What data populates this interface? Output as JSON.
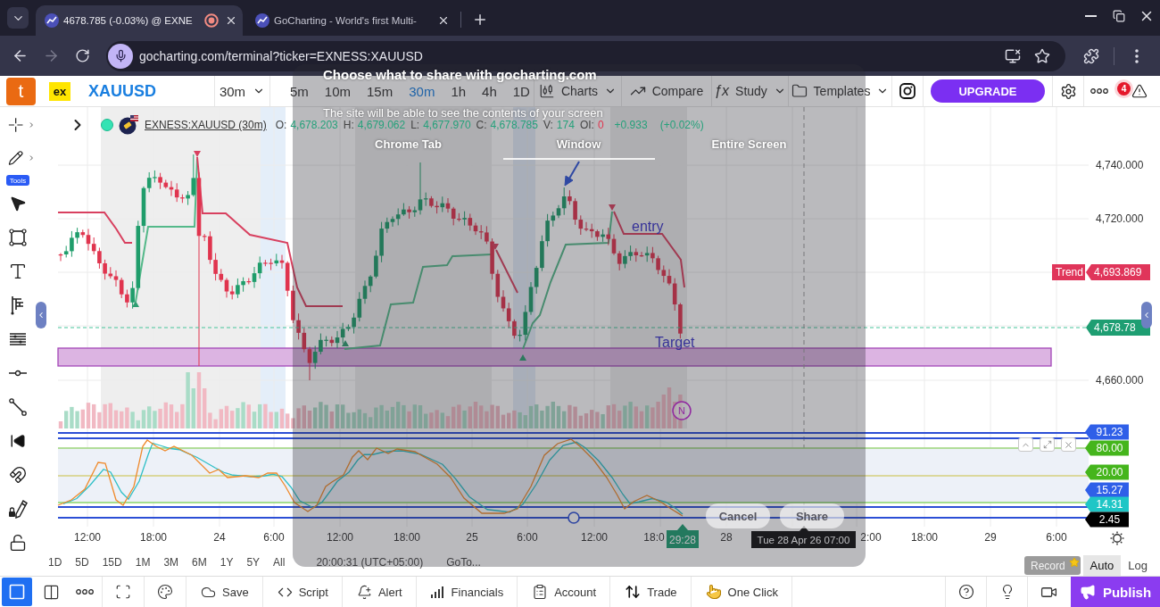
{
  "browser": {
    "tabs": [
      {
        "title": "4678.785 (-0.03%) @ EXNE",
        "selected": true,
        "recording": true
      },
      {
        "title": "GoCharting - World's first Multi-",
        "selected": false,
        "recording": false
      }
    ],
    "forward_enabled": false,
    "url": "gocharting.com/terminal?ticker=EXNESS:XAUUSD"
  },
  "toolbar": {
    "logo": "t",
    "broker": "ex",
    "symbol": "XAUUSD",
    "interval": "30m",
    "intervals": [
      {
        "label": "5m",
        "selected": false
      },
      {
        "label": "10m",
        "selected": false
      },
      {
        "label": "15m",
        "selected": false
      },
      {
        "label": "30m",
        "selected": true
      },
      {
        "label": "1h",
        "selected": false
      },
      {
        "label": "4h",
        "selected": false
      },
      {
        "label": "1D",
        "selected": false
      }
    ],
    "menus": [
      {
        "label": "Charts",
        "dropdown": true
      },
      {
        "label": "Compare",
        "dropdown": false
      },
      {
        "label": "Study",
        "glyph": "ƒx",
        "dropdown": true
      },
      {
        "label": "Templates",
        "dropdown": true
      }
    ],
    "upgrade": "UPGRADE",
    "alert_count": "4"
  },
  "tools": {
    "label": "Tools"
  },
  "chart": {
    "legend": {
      "symbol": "EXNESS:XAUUSD (30m)",
      "fields": [
        {
          "label": "O:",
          "value": "4,678.203",
          "color": "#26a17b"
        },
        {
          "label": "H:",
          "value": "4,679.062",
          "color": "#26a17b"
        },
        {
          "label": "L:",
          "value": "4,677.970",
          "color": "#26a17b"
        },
        {
          "label": "C:",
          "value": "4,678.785",
          "color": "#26a17b"
        },
        {
          "label": "V:",
          "value": "174",
          "color": "#26a17b"
        },
        {
          "label": "OI:",
          "value": "0",
          "color": "#e0344e"
        }
      ],
      "change": "+0.933",
      "change_percent": "(+0.02%)"
    },
    "price_ticks": [
      "4,740.000",
      "4,720.000",
      "4,660.000"
    ],
    "trend": {
      "label": "Trend",
      "price": "4,693.869"
    },
    "last_price": "4,678.78",
    "notes": [
      "entry",
      "Target"
    ],
    "event_marker": "N",
    "oscillator_tags": [
      {
        "value": "91.23",
        "color": "#2f5fe8"
      },
      {
        "value": "80.00",
        "color": "#45b51c"
      },
      {
        "value": "20.00",
        "color": "#45b51c"
      },
      {
        "value": "15.27",
        "color": "#2f5fe8"
      },
      {
        "value": "14.31",
        "color": "#1fc6c6"
      },
      {
        "value": "2.45",
        "color": "#000000"
      }
    ],
    "time_ticks": [
      "12:00",
      "18:00",
      "24",
      "6:00",
      "12:00",
      "18:00",
      "25",
      "6:00",
      "12:00",
      "18:0",
      "28",
      "2:00",
      "18:00",
      "29",
      "6:00"
    ],
    "countdown": "29:28",
    "crosshair_time": "Tue 28 Apr 26 07:00"
  },
  "range_bar": {
    "ranges": [
      "1D",
      "5D",
      "15D",
      "1M",
      "3M",
      "6M",
      "1Y",
      "5Y",
      "All"
    ],
    "clock": "20:00:31 (UTC+05:00)",
    "goto": "GoTo...",
    "tooltip": "Record",
    "scales": [
      {
        "label": "Auto",
        "selected": true
      },
      {
        "label": "Log",
        "selected": false
      }
    ]
  },
  "bottom_bar": {
    "layouts": [
      {
        "selected": true
      },
      {
        "selected": false
      }
    ],
    "actions": [
      "Save",
      "Script",
      "Alert",
      "Financials",
      "Account",
      "Trade",
      "One Click"
    ],
    "publish": "Publish"
  },
  "share_dialog": {
    "title": "Choose what to share with gocharting.com",
    "subtitle": "The site will be able to see the contents of your screen",
    "tabs": [
      {
        "label": "Chrome Tab",
        "selected": false
      },
      {
        "label": "Window",
        "selected": true
      },
      {
        "label": "Entire Screen",
        "selected": false
      }
    ],
    "buttons": [
      "Cancel",
      "Share"
    ]
  }
}
